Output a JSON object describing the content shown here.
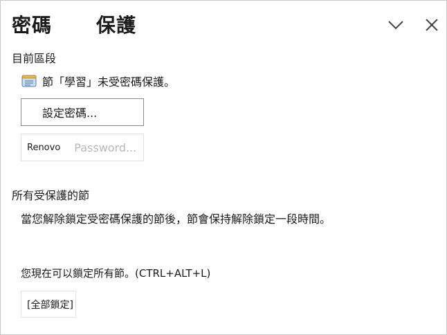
{
  "header": {
    "title_part1": "密碼",
    "title_part2": "保護",
    "collapse_icon": "chevron-down-icon",
    "close_icon": "close-icon"
  },
  "current_section": {
    "title": "目前區段",
    "status_text": "節「學習」未受密碼保護。",
    "section_icon": "section-page-icon",
    "set_password_label": "設定密碼...",
    "remove_password_prefix": "Renovo",
    "remove_password_label": "Password..."
  },
  "all_protected": {
    "title": "所有受保護的節",
    "description": "當您解除鎖定受密碼保護的節後，節會保持解除鎖定一段時間。",
    "lock_note": "您現在可以鎖定所有節。(CTRL+ALT+L)",
    "lock_all_label": "[全部鎖定]"
  }
}
